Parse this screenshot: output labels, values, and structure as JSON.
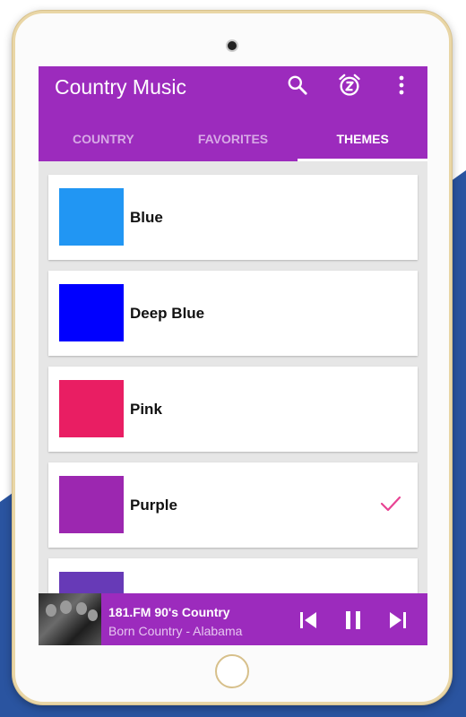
{
  "app": {
    "title": "Country Music"
  },
  "toolbar": {
    "icons": [
      "search-icon",
      "sleep-timer-icon",
      "more-vert-icon"
    ]
  },
  "tabs": [
    {
      "label": "COUNTRY",
      "active": false
    },
    {
      "label": "FAVORITES",
      "active": false
    },
    {
      "label": "THEMES",
      "active": true
    }
  ],
  "themes": [
    {
      "name": "Blue",
      "color": "#2196f3",
      "selected": false
    },
    {
      "name": "Deep Blue",
      "color": "#0000ff",
      "selected": false
    },
    {
      "name": "Pink",
      "color": "#e91e63",
      "selected": false
    },
    {
      "name": "Purple",
      "color": "#9c27b0",
      "selected": true
    },
    {
      "name": "",
      "color": "#673ab7",
      "selected": false
    }
  ],
  "player": {
    "station": "181.FM 90's Country",
    "song": "Born Country",
    "separator": " - ",
    "artist": "Alabama",
    "icons": [
      "skip-previous-icon",
      "pause-icon",
      "skip-next-icon"
    ]
  },
  "colors": {
    "primary": "#9c2bbd",
    "tab_inactive": "#d7a9e6",
    "check": "#e84393",
    "background_stripe": "#2a54a0",
    "device_frame": "#e9d6a6"
  }
}
